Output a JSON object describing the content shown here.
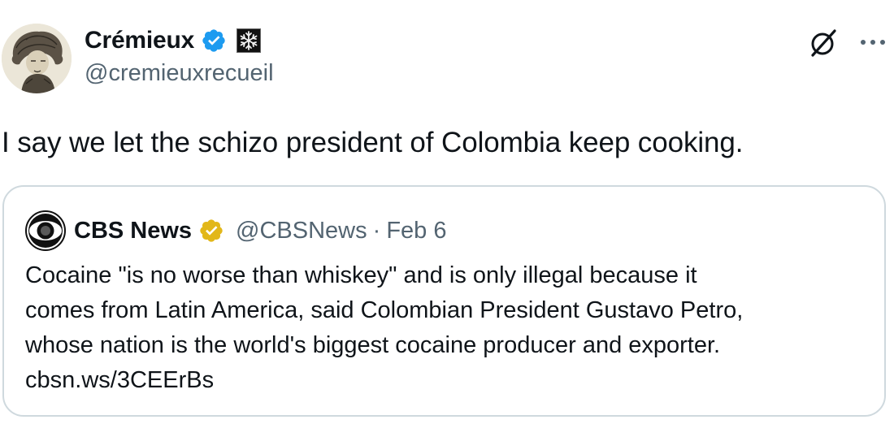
{
  "author": {
    "display_name": "Crémieux",
    "handle": "@cremieuxrecueil",
    "verified_color": "#1d9bf0",
    "affiliate_badge_icon": "snowflake-badge-icon"
  },
  "actions": {
    "grok_icon": "grok-icon",
    "more_icon": "more-icon"
  },
  "tweet": {
    "text": "I say we let the schizo president of Colombia keep cooking."
  },
  "quote": {
    "logo_icon": "cbs-eye-logo-icon",
    "display_name": "CBS News",
    "verified_color": "#e2b719",
    "handle": "@CBSNews",
    "separator": "·",
    "date": "Feb 6",
    "lines": [
      "Cocaine \"is no worse than whiskey\" and is only illegal because it",
      "comes from Latin America, said Colombian President Gustavo Petro,",
      "whose nation is the world's biggest cocaine producer and exporter.",
      "cbsn.ws/3CEErBs"
    ]
  }
}
